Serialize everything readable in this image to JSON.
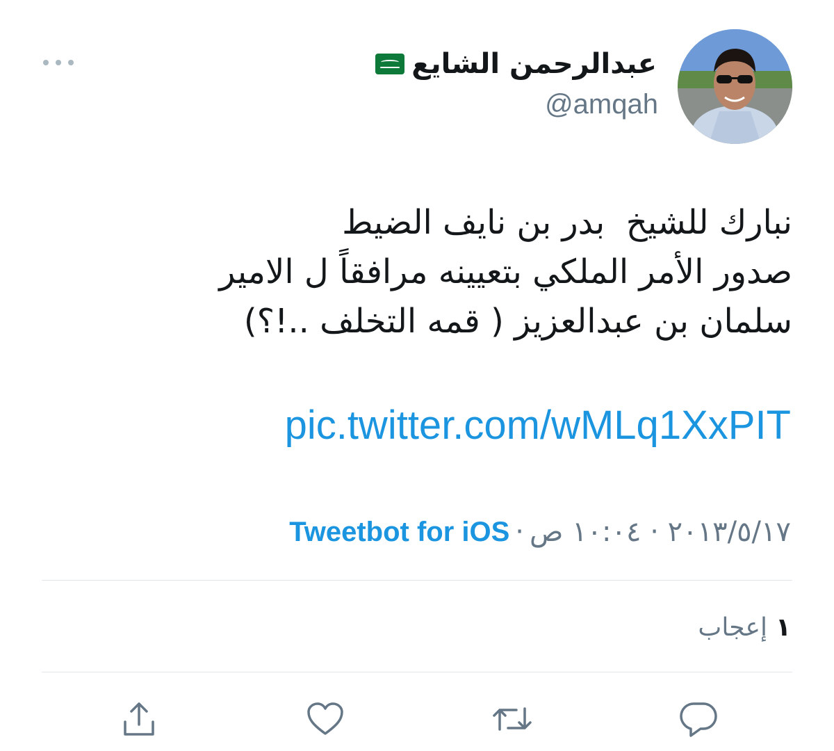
{
  "tweet": {
    "display_name": "عبدالرحمن الشايع",
    "handle": "@amqah",
    "text_lines": [
      "نبارك للشيخ  بدر بن نايف الضيط",
      "صدور الأمر الملكي بتعيينه مرافقاً ل الامير",
      "سلمان بن عبدالعزيز ( قمه التخلف ..!؟)"
    ],
    "link": "pic.twitter.com/wMLq1XxPIT",
    "date_time": "٢٠١٣/٥/١٧ · ١٠:٠٤ ص",
    "separator": "·",
    "source": "Tweetbot for iOS",
    "likes_count": "١",
    "likes_label": "إعجاب"
  },
  "icons": {
    "more": "more-horizontal-icon",
    "flag": "saudi-flag-icon",
    "reply": "reply-icon",
    "retweet": "retweet-icon",
    "like": "like-heart-icon",
    "share": "share-icon"
  },
  "colors": {
    "text": "#14171a",
    "secondary": "#657786",
    "link": "#1b95e0",
    "divider": "#e1e8ed",
    "icon": "#657786"
  }
}
